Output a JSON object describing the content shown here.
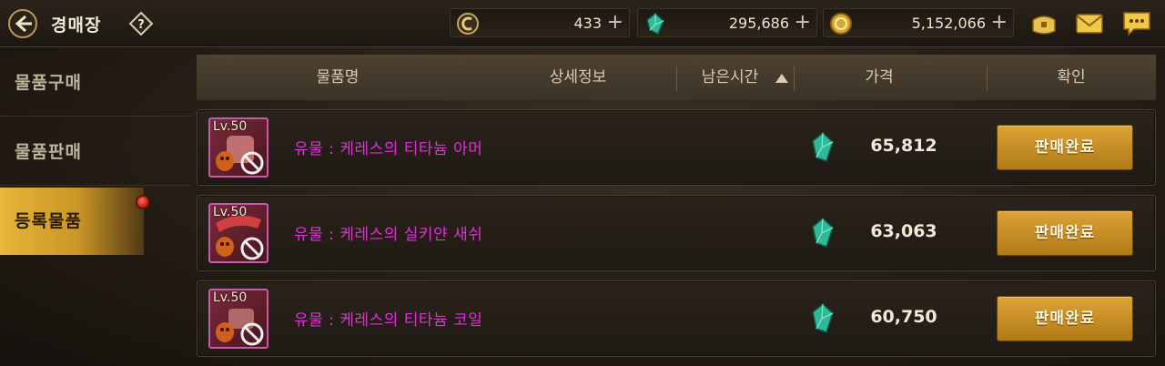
{
  "header": {
    "title": "경매장",
    "currencies": [
      {
        "icon": "silver-coin-icon",
        "value": "433"
      },
      {
        "icon": "green-gem-icon",
        "value": "295,686"
      },
      {
        "icon": "gold-coin-icon",
        "value": "5,152,066"
      }
    ],
    "plus_label": "+",
    "icons": [
      "bag-icon",
      "mail-icon",
      "chat-icon"
    ]
  },
  "nav": {
    "items": [
      {
        "label": "물품구매",
        "active": false
      },
      {
        "label": "물품판매",
        "active": false
      },
      {
        "label": "등록물품",
        "active": true,
        "notification": true
      }
    ]
  },
  "table": {
    "columns": {
      "name": "물품명",
      "detail": "상세정보",
      "time": "남은시간",
      "price": "가격",
      "confirm": "확인"
    },
    "sort": {
      "column": "time",
      "direction": "ascending"
    },
    "rows": [
      {
        "level": "Lv.50",
        "name": "유물 : 케레스의 티타늄 아머",
        "price_icon": "green-gem-icon",
        "price": "65,812",
        "action": "판매완료"
      },
      {
        "level": "Lv.50",
        "name": "유물 : 케레스의 실키얀 새쉬",
        "price_icon": "green-gem-icon",
        "price": "63,063",
        "action": "판매완료"
      },
      {
        "level": "Lv.50",
        "name": "유물 : 케레스의 티타늄 코일",
        "price_icon": "green-gem-icon",
        "price": "60,750",
        "action": "판매완료"
      }
    ]
  },
  "colors": {
    "item_name": "#e030d8",
    "button": "#c99228",
    "active_tab": "#e8b63a"
  }
}
